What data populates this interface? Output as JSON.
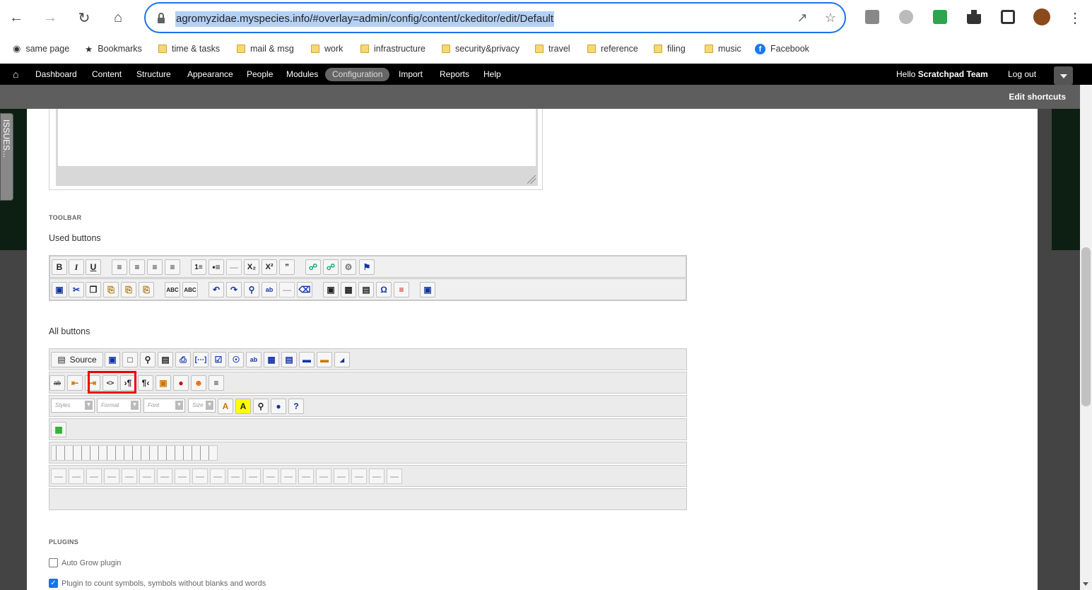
{
  "browser": {
    "url": "agromyzidae.myspecies.info/#overlay=admin/config/content/ckeditor/edit/Default",
    "bookmarks": [
      {
        "label": "same page",
        "icon": "page-icon"
      },
      {
        "label": "Bookmarks",
        "icon": "star-icon"
      },
      {
        "label": "time & tasks",
        "icon": "folder-icon"
      },
      {
        "label": "mail & msg",
        "icon": "folder-icon"
      },
      {
        "label": "work",
        "icon": "folder-icon"
      },
      {
        "label": "infrastructure",
        "icon": "folder-icon"
      },
      {
        "label": "security&privacy",
        "icon": "folder-icon"
      },
      {
        "label": "travel",
        "icon": "folder-icon"
      },
      {
        "label": "reference",
        "icon": "folder-icon"
      },
      {
        "label": "filing",
        "icon": "folder-icon"
      },
      {
        "label": "music",
        "icon": "folder-icon"
      },
      {
        "label": "Facebook",
        "icon": "facebook-icon"
      }
    ]
  },
  "admin_menu": {
    "items": [
      "Dashboard",
      "Content",
      "Structure",
      "Appearance",
      "People",
      "Modules",
      "Configuration",
      "Import",
      "Reports",
      "Help"
    ],
    "active": "Configuration",
    "greeting": "Hello",
    "user": "Scratchpad Team",
    "logout": "Log out",
    "edit_shortcuts": "Edit shortcuts"
  },
  "issues_tab": "ISSUES...",
  "toolbar": {
    "section_label": "TOOLBAR",
    "used_heading": "Used buttons",
    "all_heading": "All buttons",
    "source_label": "Source",
    "combos": [
      "Styles",
      "Format",
      "Font",
      "Size"
    ]
  },
  "plugins": {
    "section_label": "PLUGINS",
    "items": [
      {
        "label": "Auto Grow plugin",
        "checked": false
      },
      {
        "label": "Plugin to count symbols, symbols without blanks and words",
        "checked": true
      }
    ]
  }
}
